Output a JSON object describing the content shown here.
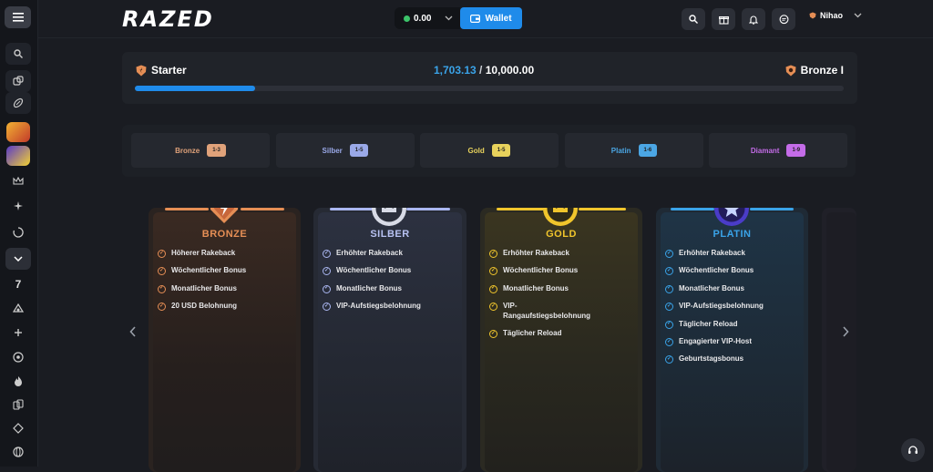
{
  "header": {
    "logo": "RAZED",
    "balance": "0.00",
    "wallet_label": "Wallet",
    "username": "Nihao"
  },
  "progress": {
    "current_tier": "Starter",
    "current_points": "1,703.13",
    "separator": " / ",
    "target_points": "10,000.00",
    "next_tier": "Bronze I",
    "fraction": 0.17
  },
  "tiers": [
    {
      "name": "Bronze",
      "levels": "1-3",
      "color": "#e0a27a"
    },
    {
      "name": "Silber",
      "levels": "1-5",
      "color": "#9aa9e8"
    },
    {
      "name": "Gold",
      "levels": "1-5",
      "color": "#e8d25c"
    },
    {
      "name": "Platin",
      "levels": "1-6",
      "color": "#4ba6e4"
    },
    {
      "name": "Diamant",
      "levels": "1-9",
      "color": "#c46ce8"
    }
  ],
  "cards": [
    {
      "title": "BRONZE",
      "color": "#e58e55",
      "perks": [
        "Höherer Rakeback",
        "Wöchentlicher Bonus",
        "Monatlicher Bonus",
        "20 USD Belohnung"
      ]
    },
    {
      "title": "SILBER",
      "color": "#aab6f0",
      "perks": [
        "Erhöhter Rakeback",
        "Wöchentlicher Bonus",
        "Monatlicher Bonus",
        "VIP-Aufstiegsbelohnung"
      ]
    },
    {
      "title": "GOLD",
      "color": "#f0c52c",
      "perks": [
        "Erhöhter Rakeback",
        "Wöchentlicher Bonus",
        "Monatlicher Bonus",
        "VIP-Rangaufstiegsbelohnung",
        "Täglicher Reload"
      ]
    },
    {
      "title": "PLATIN",
      "color": "#3aa3e8",
      "perks": [
        "Erhöhter Rakeback",
        "Wöchentlicher Bonus",
        "Monatlicher Bonus",
        "VIP-Aufstiegsbelohnung",
        "Täglicher Reload",
        "Engagierter VIP-Host",
        "Geburtstagsbonus"
      ]
    }
  ],
  "icons": {
    "menu": "menu-icon",
    "search": "search-icon",
    "gift": "gift-icon",
    "bell": "bell-icon",
    "chat": "chat-icon",
    "prev": "chevron-left-icon",
    "next": "chevron-right-icon",
    "support": "headset-icon"
  }
}
